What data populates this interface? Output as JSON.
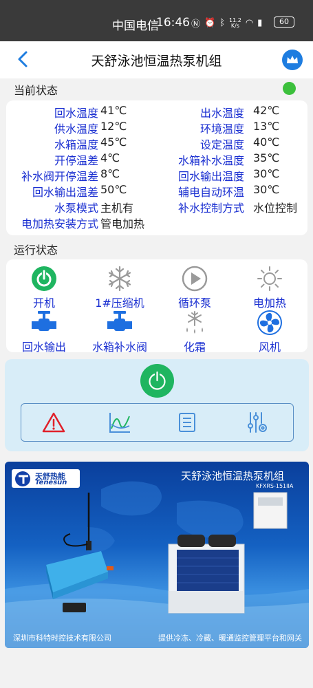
{
  "status_bar": {
    "carrier": "中国电信",
    "time": "16:46",
    "speed_value": "11.2",
    "speed_unit": "K/s",
    "battery": "60"
  },
  "header": {
    "title": "天舒泳池恒温热泵机组"
  },
  "current_status": {
    "section_title": "当前状态",
    "indicator_color": "#3cc03c",
    "params_left": [
      {
        "label": "回水温度",
        "value": "41℃"
      },
      {
        "label": "供水温度",
        "value": "12℃"
      },
      {
        "label": "水箱温度",
        "value": "45℃"
      },
      {
        "label": "开停温差",
        "value": "4℃"
      },
      {
        "label": "补水阀开停温差",
        "value": "8℃"
      },
      {
        "label": "回水输出温差",
        "value": "50℃"
      },
      {
        "label": "水泵模式",
        "value": "主机有"
      },
      {
        "label": "电加热安装方式",
        "value": "管电加热"
      }
    ],
    "params_right": [
      {
        "label": "出水温度",
        "value": "42℃"
      },
      {
        "label": "环境温度",
        "value": "13℃"
      },
      {
        "label": "设定温度",
        "value": "40℃"
      },
      {
        "label": "水箱补水温度",
        "value": "35℃"
      },
      {
        "label": "回水输出温度",
        "value": "30℃"
      },
      {
        "label": "辅电自动环温",
        "value": "30℃"
      },
      {
        "label": "补水控制方式",
        "value": "水位控制"
      }
    ]
  },
  "run_status": {
    "section_title": "运行状态",
    "items": [
      {
        "label": "开机",
        "icon": "power-on-icon",
        "active": true
      },
      {
        "label": "1#压缩机",
        "icon": "snowflake-icon",
        "active": false
      },
      {
        "label": "循环泵",
        "icon": "pump-play-icon",
        "active": false
      },
      {
        "label": "电加热",
        "icon": "sun-heater-icon",
        "active": false
      },
      {
        "label": "回水输出",
        "icon": "valve-icon",
        "active": true
      },
      {
        "label": "水箱补水阀",
        "icon": "valve-icon",
        "active": true
      },
      {
        "label": "化霜",
        "icon": "defrost-icon",
        "active": false
      },
      {
        "label": "风机",
        "icon": "fan-icon",
        "active": true
      }
    ]
  },
  "controls": {
    "power_button_color": "#1fb560",
    "tools": [
      {
        "name": "alarm-icon"
      },
      {
        "name": "curve-chart-icon"
      },
      {
        "name": "list-doc-icon"
      },
      {
        "name": "settings-sliders-icon"
      }
    ]
  },
  "banner": {
    "brand_cn": "天舒热能",
    "brand_en": "Tenesun",
    "title": "天舒泳池恒温热泵机组",
    "model": "KFXRS-151IIA",
    "footer_left": "深圳市科特时控技术有限公司",
    "footer_right": "提供冷冻、冷藏、暖通监控管理平台和网关"
  },
  "colors": {
    "label_blue": "#1a2fd1",
    "active_blue": "#1e6fe0",
    "inactive_gray": "#9a9a9a",
    "accent_green": "#1fb560"
  }
}
